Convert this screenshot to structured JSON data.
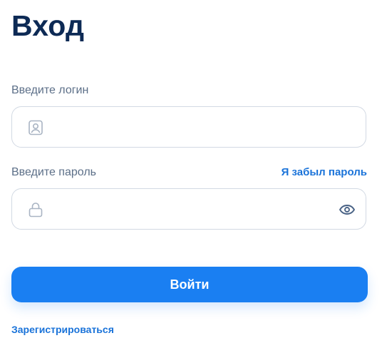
{
  "title": "Вход",
  "login": {
    "label": "Введите логин",
    "value": "",
    "placeholder": "",
    "icon": "user-card-icon"
  },
  "password": {
    "label": "Введите пароль",
    "value": "",
    "placeholder": "",
    "icon": "lock-icon",
    "toggle_icon": "eye-icon",
    "forgot_label": "Я забыл пароль"
  },
  "submit_label": "Войти",
  "register_label": "Зарегистрироваться",
  "colors": {
    "title": "#0d2a55",
    "label": "#5c6f88",
    "accent": "#1a7ff2",
    "link": "#1a73d9",
    "field_border": "#d2d9e3",
    "icon": "#a9b4c3"
  }
}
